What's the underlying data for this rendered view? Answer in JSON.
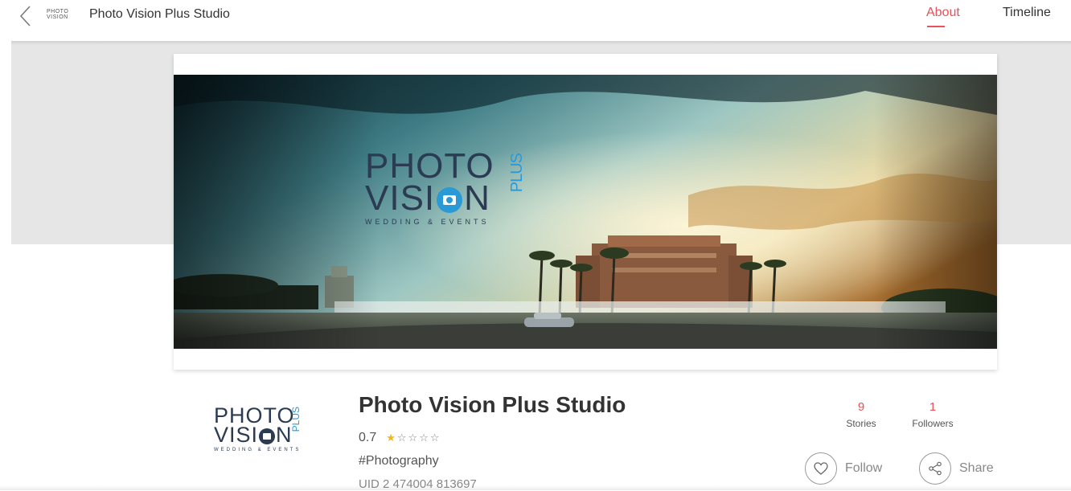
{
  "topbar": {
    "title": "Photo Vision Plus Studio",
    "mini_logo_line1": "PHOTO",
    "mini_logo_line2": "VISION",
    "nav_about": "About",
    "nav_timeline": "Timeline"
  },
  "cover": {
    "logo_line1": "PHOTO",
    "logo_line2": "VISI",
    "logo_line2_end": "N",
    "logo_plus": "PLUS",
    "logo_tagline": "WEDDING & EVENTS"
  },
  "profile": {
    "logo_line1": "PHOTO",
    "logo_line2": "VISI",
    "logo_line2_end": "N",
    "logo_plus": "PLUS",
    "logo_tagline": "WEDDING & EVENTS",
    "name": "Photo Vision Plus Studio",
    "rating": "0.7",
    "stars_full": "★",
    "stars_empty": "☆☆☆☆",
    "category": "#Photography",
    "uid": "UID 2 474004 813697"
  },
  "stats": {
    "stories_count": "9",
    "stories_label": "Stories",
    "followers_count": "1",
    "followers_label": "Followers"
  },
  "actions": {
    "follow_label": "Follow",
    "share_label": "Share"
  },
  "colors": {
    "accent": "#e8525a",
    "brand_blue": "#2a9ad6",
    "brand_navy": "#2a3b52",
    "star": "#f3b51a"
  }
}
